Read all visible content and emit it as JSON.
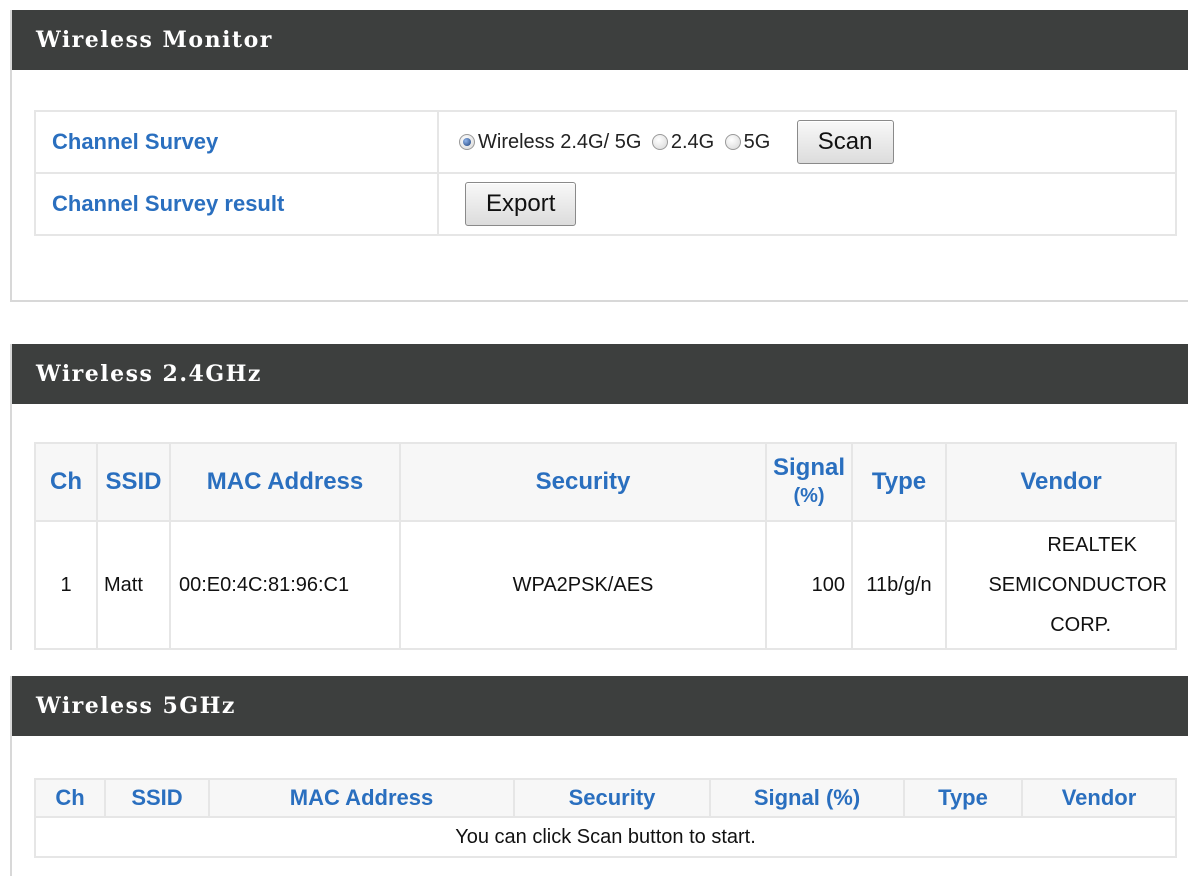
{
  "monitor": {
    "title": "Wireless Monitor",
    "channel_survey_label": "Channel Survey",
    "channel_survey_result_label": "Channel Survey result",
    "radio_options": [
      {
        "label": "Wireless 2.4G/ 5G",
        "checked": true
      },
      {
        "label": "2.4G",
        "checked": false
      },
      {
        "label": "5G",
        "checked": false
      }
    ],
    "scan_label": "Scan",
    "export_label": "Export"
  },
  "wireless24": {
    "title": "Wireless 2.4GHz",
    "headers": {
      "ch": "Ch",
      "ssid": "SSID",
      "mac": "MAC Address",
      "security": "Security",
      "signal_line1": "Signal",
      "signal_line2": "(%)",
      "type": "Type",
      "vendor": "Vendor"
    },
    "rows": [
      {
        "ch": "1",
        "ssid": "Matt",
        "mac": "00:E0:4C:81:96:C1",
        "security": "WPA2PSK/AES",
        "signal": "100",
        "type": "11b/g/n",
        "vendor_line1": "REALTEK",
        "vendor_line2": "SEMICONDUCTOR",
        "vendor_line3": "CORP."
      }
    ]
  },
  "wireless5": {
    "title": "Wireless 5GHz",
    "headers": {
      "ch": "Ch",
      "ssid": "SSID",
      "mac": "MAC Address",
      "security": "Security",
      "signal": "Signal (%)",
      "type": "Type",
      "vendor": "Vendor"
    },
    "empty_message": "You can click Scan button to start."
  },
  "colors": {
    "header_bg": "#3d3f3e",
    "label_blue": "#2a6fbf"
  }
}
